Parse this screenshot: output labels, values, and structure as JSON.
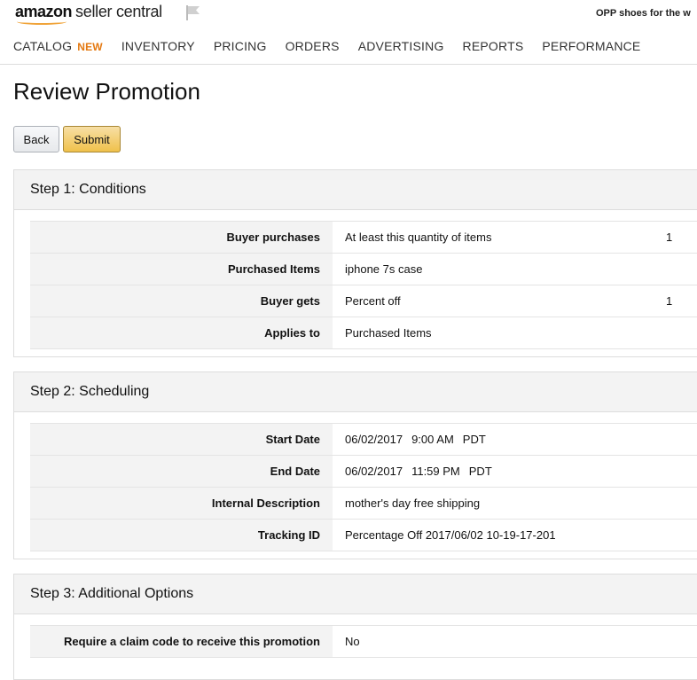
{
  "header": {
    "logo_amazon": "amazon",
    "logo_suffix": "seller central",
    "store_name": "OPP shoes for the w"
  },
  "nav": [
    {
      "label": "CATALOG",
      "badge": "NEW"
    },
    {
      "label": "INVENTORY"
    },
    {
      "label": "PRICING"
    },
    {
      "label": "ORDERS"
    },
    {
      "label": "ADVERTISING"
    },
    {
      "label": "REPORTS"
    },
    {
      "label": "PERFORMANCE"
    }
  ],
  "page_title": "Review Promotion",
  "buttons": {
    "back": "Back",
    "submit": "Submit"
  },
  "step1": {
    "title": "Step 1: Conditions",
    "rows": [
      {
        "label": "Buyer purchases",
        "value": "At least this quantity of items",
        "qty": "1"
      },
      {
        "label": "Purchased Items",
        "value": "iphone 7s case"
      },
      {
        "label": "Buyer gets",
        "value": "Percent off",
        "qty": "1"
      },
      {
        "label": "Applies to",
        "value": "Purchased Items"
      }
    ]
  },
  "step2": {
    "title": "Step 2: Scheduling",
    "rows": [
      {
        "label": "Start Date",
        "date": "06/02/2017",
        "time": "9:00 AM",
        "tz": "PDT"
      },
      {
        "label": "End Date",
        "date": "06/02/2017",
        "time": "11:59 PM",
        "tz": "PDT"
      },
      {
        "label": "Internal Description",
        "value": "mother's day free shipping"
      },
      {
        "label": "Tracking ID",
        "value": "Percentage Off 2017/06/02 10-19-17-201"
      }
    ]
  },
  "step3": {
    "title": "Step 3: Additional Options",
    "rows": [
      {
        "label": "Require a claim code to receive this promotion",
        "value": "No"
      }
    ]
  }
}
